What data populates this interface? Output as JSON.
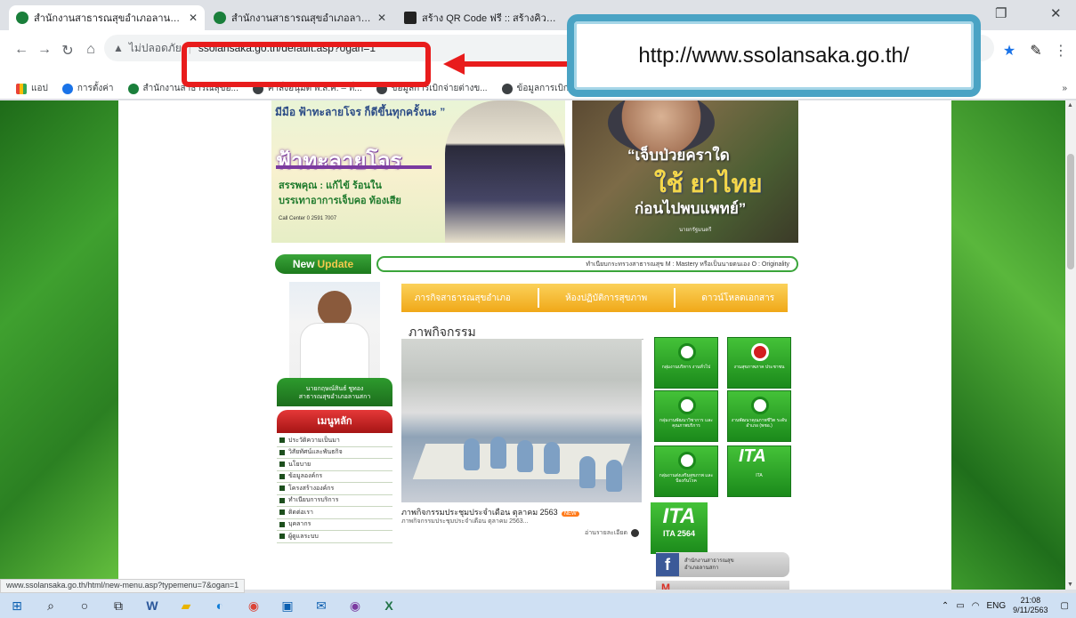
{
  "browser": {
    "tabs": [
      {
        "label": "สำนักงานสาธารณสุขอำเภอลานสกา ห",
        "favicon": "moph-icon",
        "active": true
      },
      {
        "label": "สำนักงานสาธารณสุขอำเภอลานสกา ห",
        "favicon": "moph-icon",
        "active": false
      },
      {
        "label": "สร้าง QR Code ฟรี :: สร้างคิวอาร์โค้ด",
        "favicon": "qr-icon",
        "active": false
      }
    ],
    "security_label": "ไม่ปลอดภัย",
    "url": "ssolansaka.go.th/default.asp?ogan=1",
    "bookmarks": [
      "แอป",
      "การตั้งค่า",
      "สำนักงานสาธารณสุขอ...",
      "คำสั่งอนุมัติ พ.ส.ค. – ที่...",
      "ข้อมูลการเบิกจ่ายต่างข...",
      "ข้อมูลการเบิกจ่ายข..."
    ]
  },
  "callout": {
    "text": "http://www.ssolansaka.go.th/"
  },
  "site": {
    "banner_left": {
      "quote": "มีมือ ฟ้าทะลายโจร ก็ดีขึ้นทุกครั้งนะ ”",
      "title": "ฟ้าทะลายโจร",
      "line1": "สรรพคุณ : แก้ไข้ ร้อนใน",
      "line2": "บรรเทาอาการเจ็บคอ ท้องเสีย",
      "small": "Call Center 0 2591 7007"
    },
    "banner_right": {
      "line1": "“เจ็บป่วยคราใด",
      "line2": "ใช้ ยาไทย",
      "line3": "ก่อนไปพบแพทย์”",
      "small": "นายกรัฐมนตรี"
    },
    "update": {
      "new": "New",
      "update": "Update",
      "marquee": "ทำเนียบกระทรวงสาธารณสุข M : Mastery หรือเป็นนายตนเอง O : Originality"
    },
    "director": {
      "name": "นายกฤษณ์สินธ์ ชูทอง",
      "title": "สาธารณสุขอำเภอลานสกา"
    },
    "menu": {
      "heading": "เมนูหลัก",
      "items": [
        "ประวัติความเป็นมา",
        "วิสัยทัศน์และพันธกิจ",
        "นโยบาย",
        "ข้อมูลองค์กร",
        "โครงสร้างองค์กร",
        "ทำเนียบการบริการ",
        "ติดต่อเรา",
        "บุคลากร",
        "ผู้ดูแลระบบ"
      ]
    },
    "tabs": [
      "ภารกิจสาธารณสุขอำเภอ",
      "ห้องปฏิบัติการสุขภาพ",
      "ดาวน์โหลดเอกสาร"
    ],
    "activity": {
      "heading": "ภาพกิจกรรม",
      "caption": "ภาพกิจกรรมประชุมประจำเดือน ตุลาคม 2563",
      "new_badge": "NEW",
      "sub": "ภาพกิจกรรมประชุมประจำเดือน ตุลาคม 2563...",
      "more": "อ่านรายละเอียด"
    },
    "groups": [
      {
        "label": "กลุ่มงานบริหาร งานทั่วไป",
        "icon": "moph-icon"
      },
      {
        "label": "งานสุขภาพภาค ประชาชน",
        "icon": "red-emblem-icon"
      },
      {
        "label": "กลุ่มงานพัฒนาวิชาการ และคุณภาพบริการ",
        "icon": "moph-icon"
      },
      {
        "label": "งานพัฒนาคุณภาพชีวิต ระดับอำเภอ (พชอ.)",
        "icon": "moph-icon"
      },
      {
        "label": "กลุ่มงานส่งเสริมสุขภาพ และป้องกันโรค",
        "icon": "moph-icon"
      },
      {
        "label": "ITA",
        "icon": "ita-logo"
      }
    ],
    "ita_year": {
      "logo": "ITA",
      "label": "ITA 2564"
    },
    "facebook": {
      "line1": "สำนักงานสาธารณสุข",
      "line2": "อำเภอลานสกา"
    },
    "gmail_label": "M"
  },
  "status_url": "www.ssolansaka.go.th/html/new-menu.asp?typemenu=7&ogan=1",
  "taskbar": {
    "lang": "ENG",
    "time": "21:08",
    "date": "9/11/2563"
  },
  "colors": {
    "highlight": "#e81c1c",
    "callout_border": "#4aa3c4",
    "site_green": "#1b8a1b"
  }
}
